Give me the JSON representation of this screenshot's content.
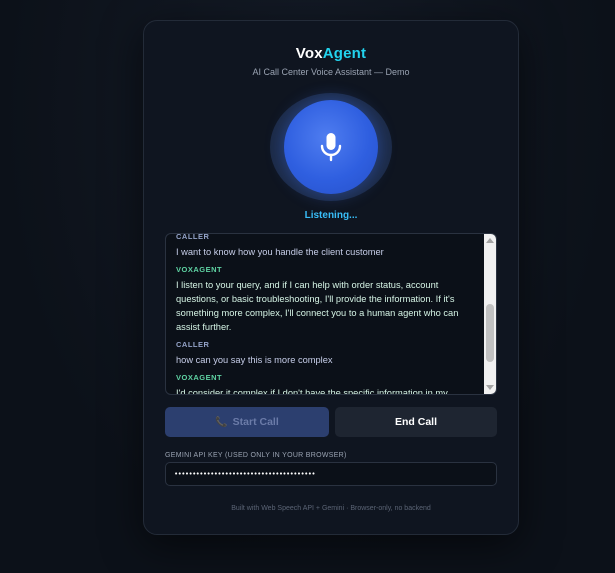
{
  "app": {
    "title_main": "Vox",
    "title_accent": "Agent",
    "subtitle": "AI Call Center Voice Assistant — Demo",
    "accent_color": "#22d3ee"
  },
  "mic": {
    "icon": "microphone-icon",
    "status": "Listening..."
  },
  "transcript": {
    "messages": [
      {
        "speaker": "CALLER",
        "text": "I want to know how you handle the client customer"
      },
      {
        "speaker": "VOXAGENT",
        "text": "I listen to your query, and if I can help with order status, account questions, or basic troubleshooting, I'll provide the information. If it's something more complex, I'll connect you to a human agent who can assist further."
      },
      {
        "speaker": "CALLER",
        "text": "how can you say this is more complex"
      },
      {
        "speaker": "VOXAGENT",
        "text": "I'd consider it complex if I don't have the specific information in my database, if it requires a human's judgment or expertise, or if it's a very"
      }
    ]
  },
  "buttons": {
    "start_label": "Start Call",
    "end_label": "End Call"
  },
  "api_key": {
    "label": "GEMINI API KEY (USED ONLY IN YOUR BROWSER)",
    "value": "•••••••••••••••••••••••••••••••••••••••"
  },
  "footer": {
    "text": "Built with Web Speech API + Gemini · Browser-only, no backend"
  }
}
